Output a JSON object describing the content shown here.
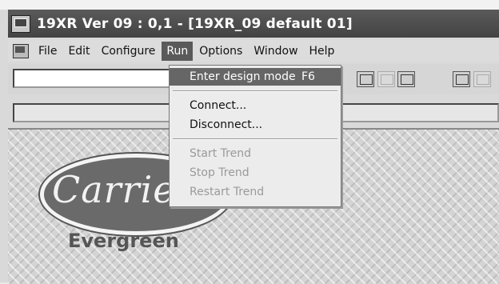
{
  "window": {
    "title": "19XR Ver 09 : 0,1 - [19XR_09 default 01]"
  },
  "menubar": {
    "items": [
      {
        "label": "File"
      },
      {
        "label": "Edit"
      },
      {
        "label": "Configure"
      },
      {
        "label": "Run",
        "active": true
      },
      {
        "label": "Options"
      },
      {
        "label": "Window"
      },
      {
        "label": "Help"
      }
    ]
  },
  "run_menu": {
    "items": [
      {
        "label": "Enter design mode",
        "accelerator": "F6",
        "state": "highlighted"
      },
      {
        "label": "Connect...",
        "state": "enabled"
      },
      {
        "label": "Disconnect...",
        "state": "enabled"
      },
      {
        "label": "Start Trend",
        "state": "disabled"
      },
      {
        "label": "Stop Trend",
        "state": "disabled"
      },
      {
        "label": "Restart Trend",
        "state": "disabled"
      }
    ]
  },
  "toolbar": {
    "input_value": "",
    "buttons": [
      {
        "icon": "open-folder-icon",
        "enabled": true
      },
      {
        "icon": "blank-doc-icon",
        "enabled": false
      },
      {
        "icon": "edit-icon",
        "enabled": true
      },
      {
        "icon": "screens-icon",
        "enabled": true
      },
      {
        "icon": "screens-disabled-icon",
        "enabled": false
      }
    ]
  },
  "address_bar": {
    "value": ""
  },
  "branding": {
    "logo_text": "Carrier",
    "product_text": "Evergreen"
  }
}
